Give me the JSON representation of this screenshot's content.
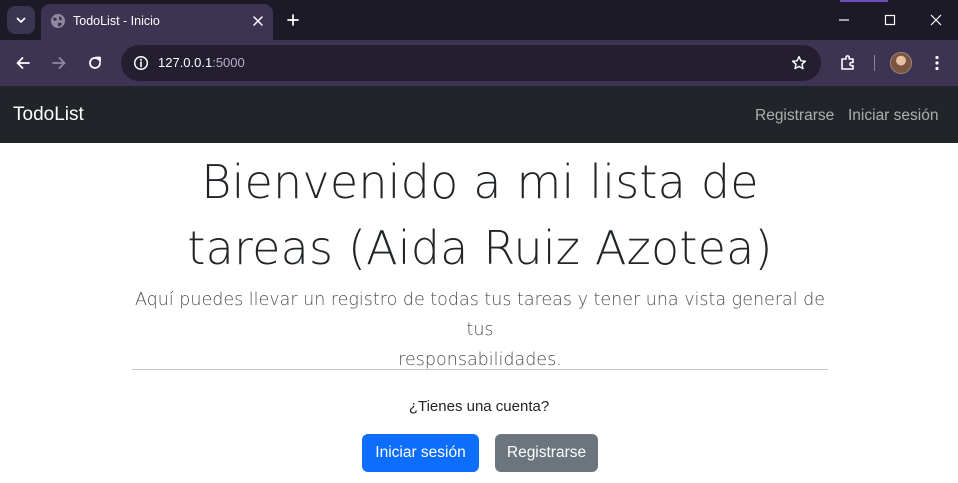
{
  "browser": {
    "tab": {
      "title": "TodoList - Inicio"
    },
    "address_bar": {
      "host": "127.0.0.1",
      "port": ":5000"
    }
  },
  "navbar": {
    "brand": "TodoList",
    "links": [
      {
        "label": "Registrarse"
      },
      {
        "label": "Iniciar sesión"
      }
    ]
  },
  "hero": {
    "title_line1": "Bienvenido a mi lista de",
    "title_line2": "tareas (Aida Ruiz Azotea)",
    "lead_line1": "Aquí puedes llevar un registro de todas tus tareas y tener una vista general de tus",
    "lead_line2": "responsabilidades.",
    "question": "¿Tienes una cuenta?",
    "primary_button": "Iniciar sesión",
    "secondary_button": "Registrarse"
  },
  "colors": {
    "chrome_dark": "#1c1a26",
    "chrome_toolbar": "#3c3452",
    "navbar_bg": "#212529",
    "primary": "#0d6efd",
    "secondary": "#6c757d"
  },
  "icons": [
    "tab-search-icon",
    "globe-favicon-icon",
    "close-icon",
    "plus-icon",
    "minimize-icon",
    "maximize-icon",
    "window-close-icon",
    "back-arrow-icon",
    "forward-arrow-icon",
    "reload-icon",
    "site-info-icon",
    "star-icon",
    "puzzle-extension-icon",
    "profile-avatar",
    "more-vert-icon"
  ]
}
